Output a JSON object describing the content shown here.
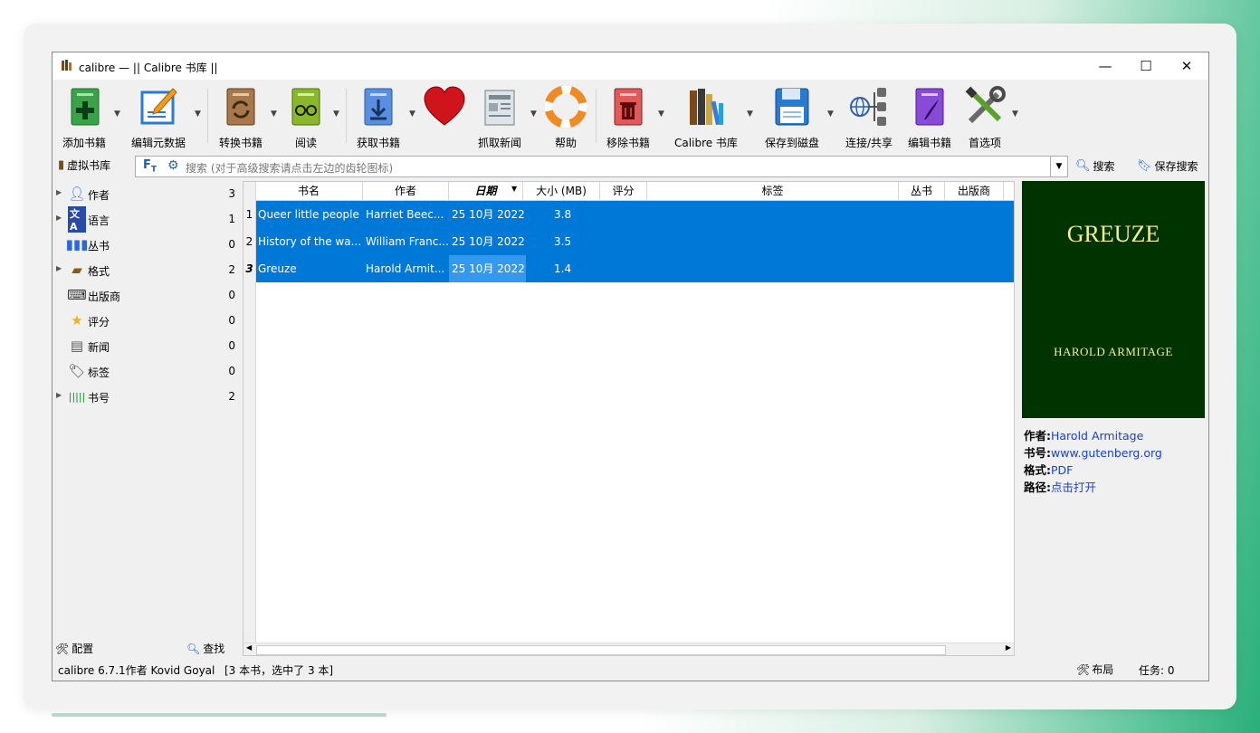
{
  "window": {
    "title": "calibre — || Calibre 书库 ||",
    "controls": {
      "minimize": "—",
      "maximize": "☐",
      "close": "✕"
    }
  },
  "toolbar": {
    "buttons": [
      {
        "label": "添加书籍",
        "icon": "add-book-icon"
      },
      {
        "label": "编辑元数据",
        "icon": "edit-metadata-icon"
      },
      {
        "label": "转换书籍",
        "icon": "convert-book-icon"
      },
      {
        "label": "阅读",
        "icon": "read-book-icon"
      },
      {
        "label": "获取书籍",
        "icon": "get-books-icon"
      },
      {
        "label": "",
        "icon": "heart-icon"
      },
      {
        "label": "抓取新闻",
        "icon": "fetch-news-icon"
      },
      {
        "label": "帮助",
        "icon": "help-icon"
      },
      {
        "label": "移除书籍",
        "icon": "remove-book-icon"
      },
      {
        "label": "Calibre 书库",
        "icon": "library-icon"
      },
      {
        "label": "保存到磁盘",
        "icon": "save-disk-icon"
      },
      {
        "label": "连接/共享",
        "icon": "connect-share-icon"
      },
      {
        "label": "编辑书籍",
        "icon": "edit-book-icon"
      },
      {
        "label": "首选项",
        "icon": "preferences-icon"
      }
    ]
  },
  "searchbar": {
    "virtual_library": "虚拟书库",
    "placeholder": "搜索 (对于高级搜索请点击左边的齿轮图标)",
    "search_label": "搜索",
    "save_search_label": "保存搜索"
  },
  "sidebar": {
    "items": [
      {
        "label": "作者",
        "count": "3",
        "icon": "author-icon",
        "expandable": true
      },
      {
        "label": "语言",
        "count": "1",
        "icon": "language-icon",
        "expandable": true
      },
      {
        "label": "丛书",
        "count": "0",
        "icon": "series-icon",
        "expandable": false
      },
      {
        "label": "格式",
        "count": "2",
        "icon": "format-icon",
        "expandable": true
      },
      {
        "label": "出版商",
        "count": "0",
        "icon": "publisher-icon",
        "expandable": false
      },
      {
        "label": "评分",
        "count": "0",
        "icon": "rating-icon",
        "expandable": false
      },
      {
        "label": "新闻",
        "count": "0",
        "icon": "news-icon",
        "expandable": false
      },
      {
        "label": "标签",
        "count": "0",
        "icon": "tag-icon",
        "expandable": false
      },
      {
        "label": "书号",
        "count": "2",
        "icon": "barcode-icon",
        "expandable": true
      }
    ],
    "configure_label": "配置",
    "find_label": "查找"
  },
  "booklist": {
    "columns": [
      "书名",
      "作者",
      "日期",
      "大小 (MB)",
      "评分",
      "标签",
      "丛书",
      "出版商"
    ],
    "rows": [
      {
        "num": "1",
        "title": "Queer little people",
        "author": "Harriet Beec...",
        "date": "25 10月 2022",
        "size": "3.8"
      },
      {
        "num": "2",
        "title": "History of the wa...",
        "author": "William Franc...",
        "date": "25 10月 2022",
        "size": "3.5"
      },
      {
        "num": "3",
        "title": "Greuze",
        "author": "Harold Armit...",
        "date": "25 10月 2022",
        "size": "1.4"
      }
    ]
  },
  "cover": {
    "title": "GREUZE",
    "author": "HAROLD ARMITAGE",
    "bg_color": "#003300",
    "text_color": "#f6f08a"
  },
  "details": {
    "author_label": "作者:",
    "author_value": "Harold Armitage",
    "id_label": "书号:",
    "id_value": "www.gutenberg.org",
    "format_label": "格式:",
    "format_value": "PDF",
    "path_label": "路径:",
    "path_value": "点击打开"
  },
  "statusbar": {
    "version": "calibre 6.7.1作者 Kovid Goyal",
    "selection": "[3 本书，选中了 3 本]",
    "layout_label": "布局",
    "jobs_label": "任务:  0"
  },
  "colors": {
    "selection": "#0078d7",
    "link": "#1a3fd0"
  }
}
